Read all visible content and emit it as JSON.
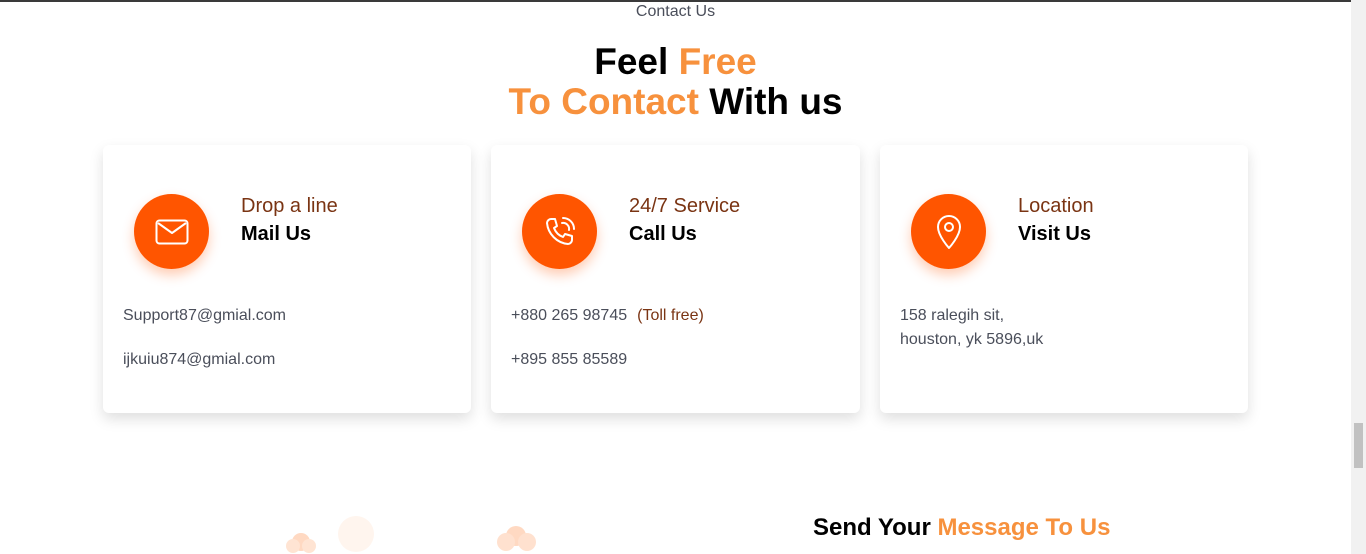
{
  "section": {
    "subtitle": "Contact Us",
    "heading": {
      "line1_part1": "Feel",
      "line1_part2": "Free",
      "line2_part1": "To Contact",
      "line2_part2": "With us"
    }
  },
  "cards": [
    {
      "icon": "mail-icon",
      "kicker": "Drop a line",
      "title": "Mail Us",
      "lines": [
        "Support87@gmial.com",
        "ijkuiu874@gmial.com"
      ]
    },
    {
      "icon": "phone-icon",
      "kicker": "24/7 Service",
      "title": "Call Us",
      "lines": [
        "+880 265 98745",
        "+895 855 85589"
      ],
      "toll_note": "(Toll free)"
    },
    {
      "icon": "location-pin-icon",
      "kicker": "Location",
      "title": "Visit Us",
      "lines": [
        "158 ralegih sit,",
        "houston, yk 5896,uk"
      ]
    }
  ],
  "send_message": {
    "part1": "Send Your",
    "part2": "Message To Us"
  },
  "colors": {
    "accent_orange": "#f7913d",
    "icon_bg": "#ff5500",
    "kicker_brown": "#7a3413",
    "body_text": "#4a4e5a"
  }
}
